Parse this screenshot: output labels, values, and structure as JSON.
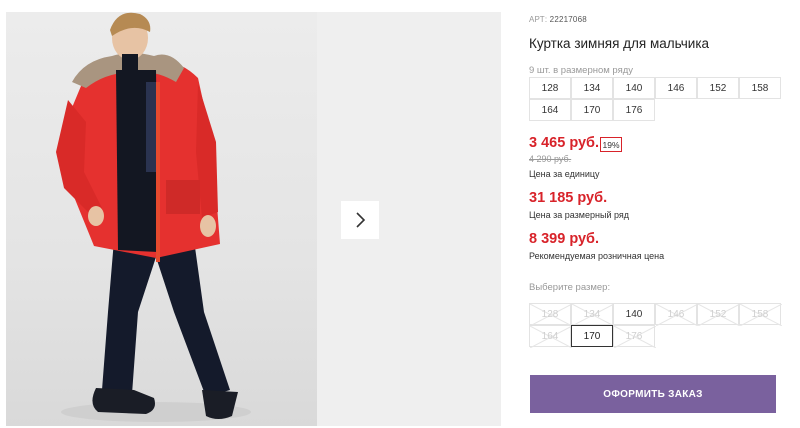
{
  "product": {
    "article_label": "АРТ",
    "article_number": "22217068",
    "title": "Куртка зимняя для мальчика",
    "sizes_note": "9 шт. в размерном ряду",
    "size_row": [
      "128",
      "134",
      "140",
      "146",
      "152",
      "158",
      "164",
      "170",
      "176"
    ],
    "price_unit": "3 465 руб.",
    "discount": "19%",
    "old_price": "4 290 руб.",
    "price_unit_caption": "Цена за единицу",
    "price_row": "31 185 руб.",
    "price_row_caption": "Цена за размерный ряд",
    "price_retail": "8 399 руб.",
    "price_retail_caption": "Рекомендуемая розничная цена"
  },
  "size_picker": {
    "label": "Выберите размер:",
    "sizes": [
      {
        "label": "128",
        "available": false
      },
      {
        "label": "134",
        "available": false
      },
      {
        "label": "140",
        "available": true
      },
      {
        "label": "146",
        "available": false
      },
      {
        "label": "152",
        "available": false
      },
      {
        "label": "158",
        "available": false
      },
      {
        "label": "164",
        "available": false
      },
      {
        "label": "170",
        "available": true,
        "selected": true
      },
      {
        "label": "176",
        "available": false
      }
    ]
  },
  "order_button": "ОФОРМИТЬ ЗАКАЗ",
  "gallery": {
    "next_icon": "chevron-right-icon"
  },
  "colors": {
    "accent": "#d8232a",
    "button": "#7a619e",
    "jacket": "#e5312f"
  }
}
